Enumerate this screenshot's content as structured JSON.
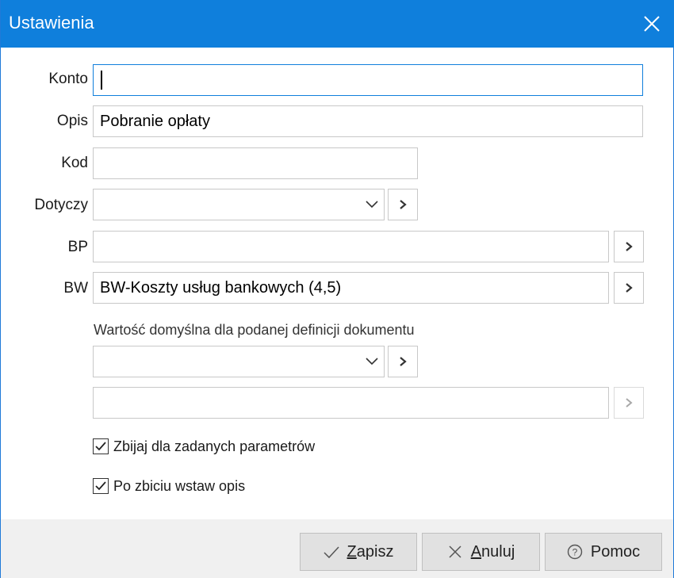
{
  "window": {
    "title": "Ustawienia"
  },
  "form": {
    "konto": {
      "label": "Konto",
      "value": ""
    },
    "opis": {
      "label": "Opis",
      "value": "Pobranie opłaty"
    },
    "kod": {
      "label": "Kod",
      "value": ""
    },
    "dotyczy": {
      "label": "Dotyczy",
      "value": ""
    },
    "bp": {
      "label": "BP",
      "value": ""
    },
    "bw": {
      "label": "BW",
      "value": "BW-Koszty usług bankowych (4,5)"
    },
    "default_hint": "Wartość domyślna dla podanej definicji dokumentu",
    "default_combo_value": "",
    "default_field_value": ""
  },
  "options": {
    "zbijaj": {
      "label": "Zbijaj dla zadanych parametrów",
      "checked": true
    },
    "po_zbiciu": {
      "label": "Po zbiciu wstaw opis",
      "checked": true
    }
  },
  "buttons": {
    "save": {
      "accel": "Z",
      "rest": "apisz",
      "icon": "check-icon"
    },
    "cancel": {
      "accel": "A",
      "rest": "nuluj",
      "icon": "x-icon"
    },
    "help": {
      "label": "Pomoc",
      "icon": "help-circle-icon"
    }
  },
  "colors": {
    "titlebar": "#0f7fdc",
    "focus_border": "#0f7fdc",
    "footer": "#f0f0f0"
  }
}
